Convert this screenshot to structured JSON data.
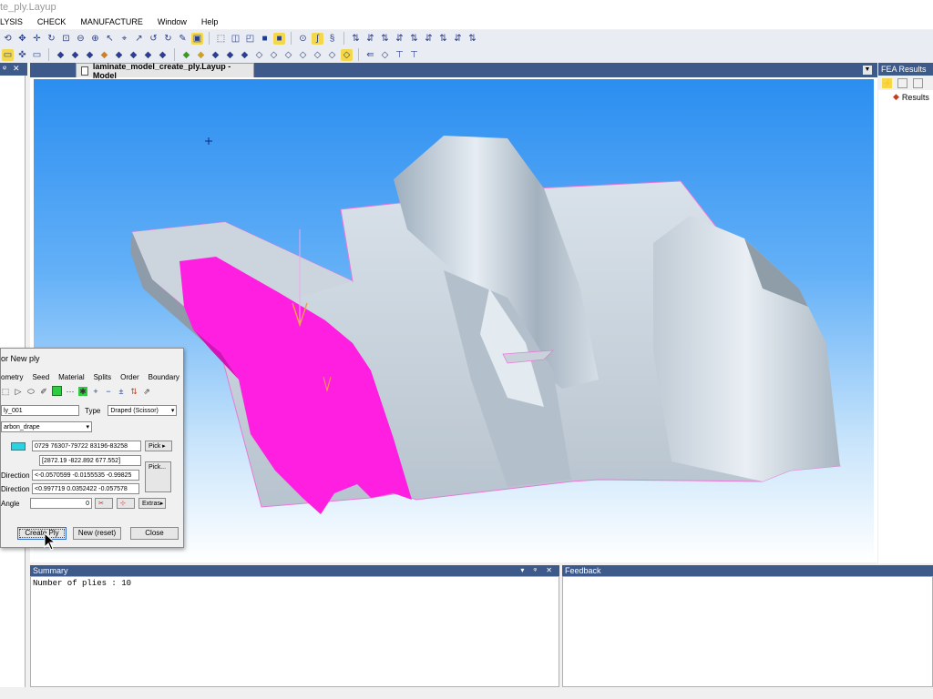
{
  "window": {
    "title": "te_ply.Layup"
  },
  "menu": [
    "LYSIS",
    "CHECK",
    "MANUFACTURE",
    "Window",
    "Help"
  ],
  "model": {
    "tab_title": "laminate_model_create_ply.Layup - Model"
  },
  "fea": {
    "title": "FEA Results",
    "tree_item": "Results"
  },
  "summary": {
    "title": "Summary",
    "text": "Number of plies : 10"
  },
  "feedback": {
    "title": "Feedback"
  },
  "dialog": {
    "title": "or New ply",
    "tabs": [
      "ometry",
      "Seed",
      "Material",
      "Splits",
      "Order",
      "Boundary"
    ],
    "name_value": "ly_001",
    "type_label": "Type",
    "type_value": "Draped (Scissor)",
    "material_value": "arbon_drape",
    "color_hex": "#29d4e0",
    "color_value": "0729 76307-79722 83196-83258",
    "pick_label": "Pick",
    "seed_value": "[2872.19 -822.892 677.552]",
    "pick2_label": "Pick...",
    "dir1_label": "Direction",
    "dir1_value": "<-0.0570599 -0.0155535 -0.99825",
    "dir2_label": "Direction",
    "dir2_value": "<0.997719 0.0352422 -0.057578",
    "angle_label": "Angle",
    "angle_value": "0",
    "extras_label": "Extras",
    "create_label": "Create Ply",
    "reset_label": "New (reset)",
    "close_label": "Close"
  },
  "colors": {
    "ply": "#ff1fe0",
    "panel_header": "#3d5a8a",
    "part": "#c4cfd9"
  }
}
